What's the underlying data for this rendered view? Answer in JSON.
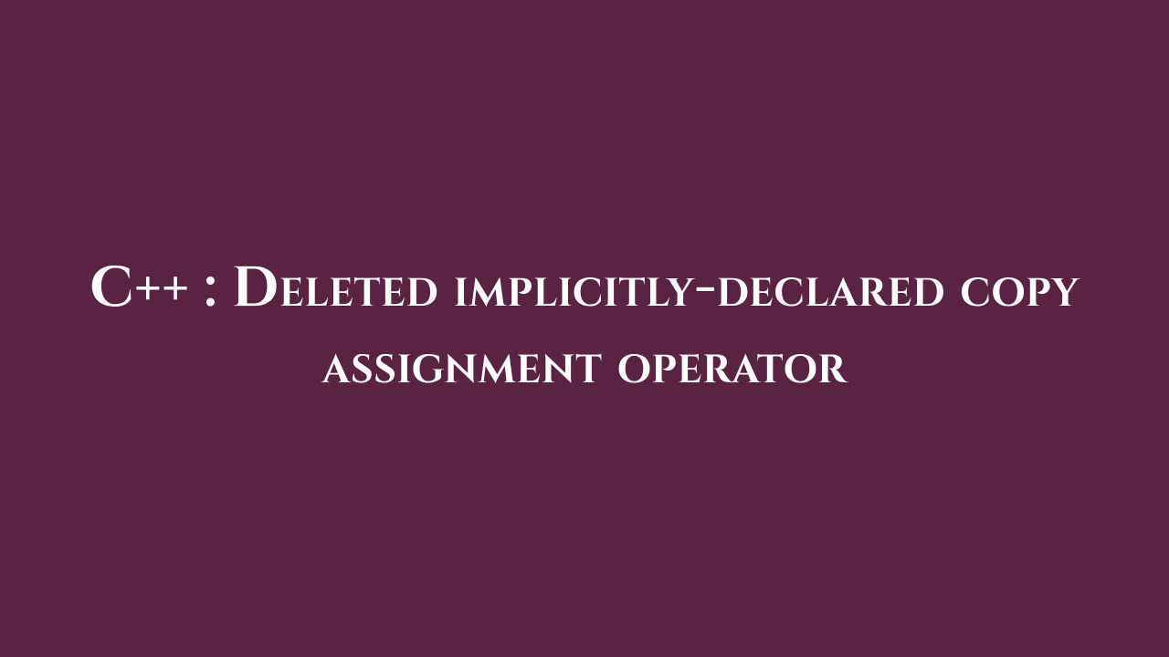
{
  "title": "C++ : Deleted implicitly-declared copy assignment operator"
}
